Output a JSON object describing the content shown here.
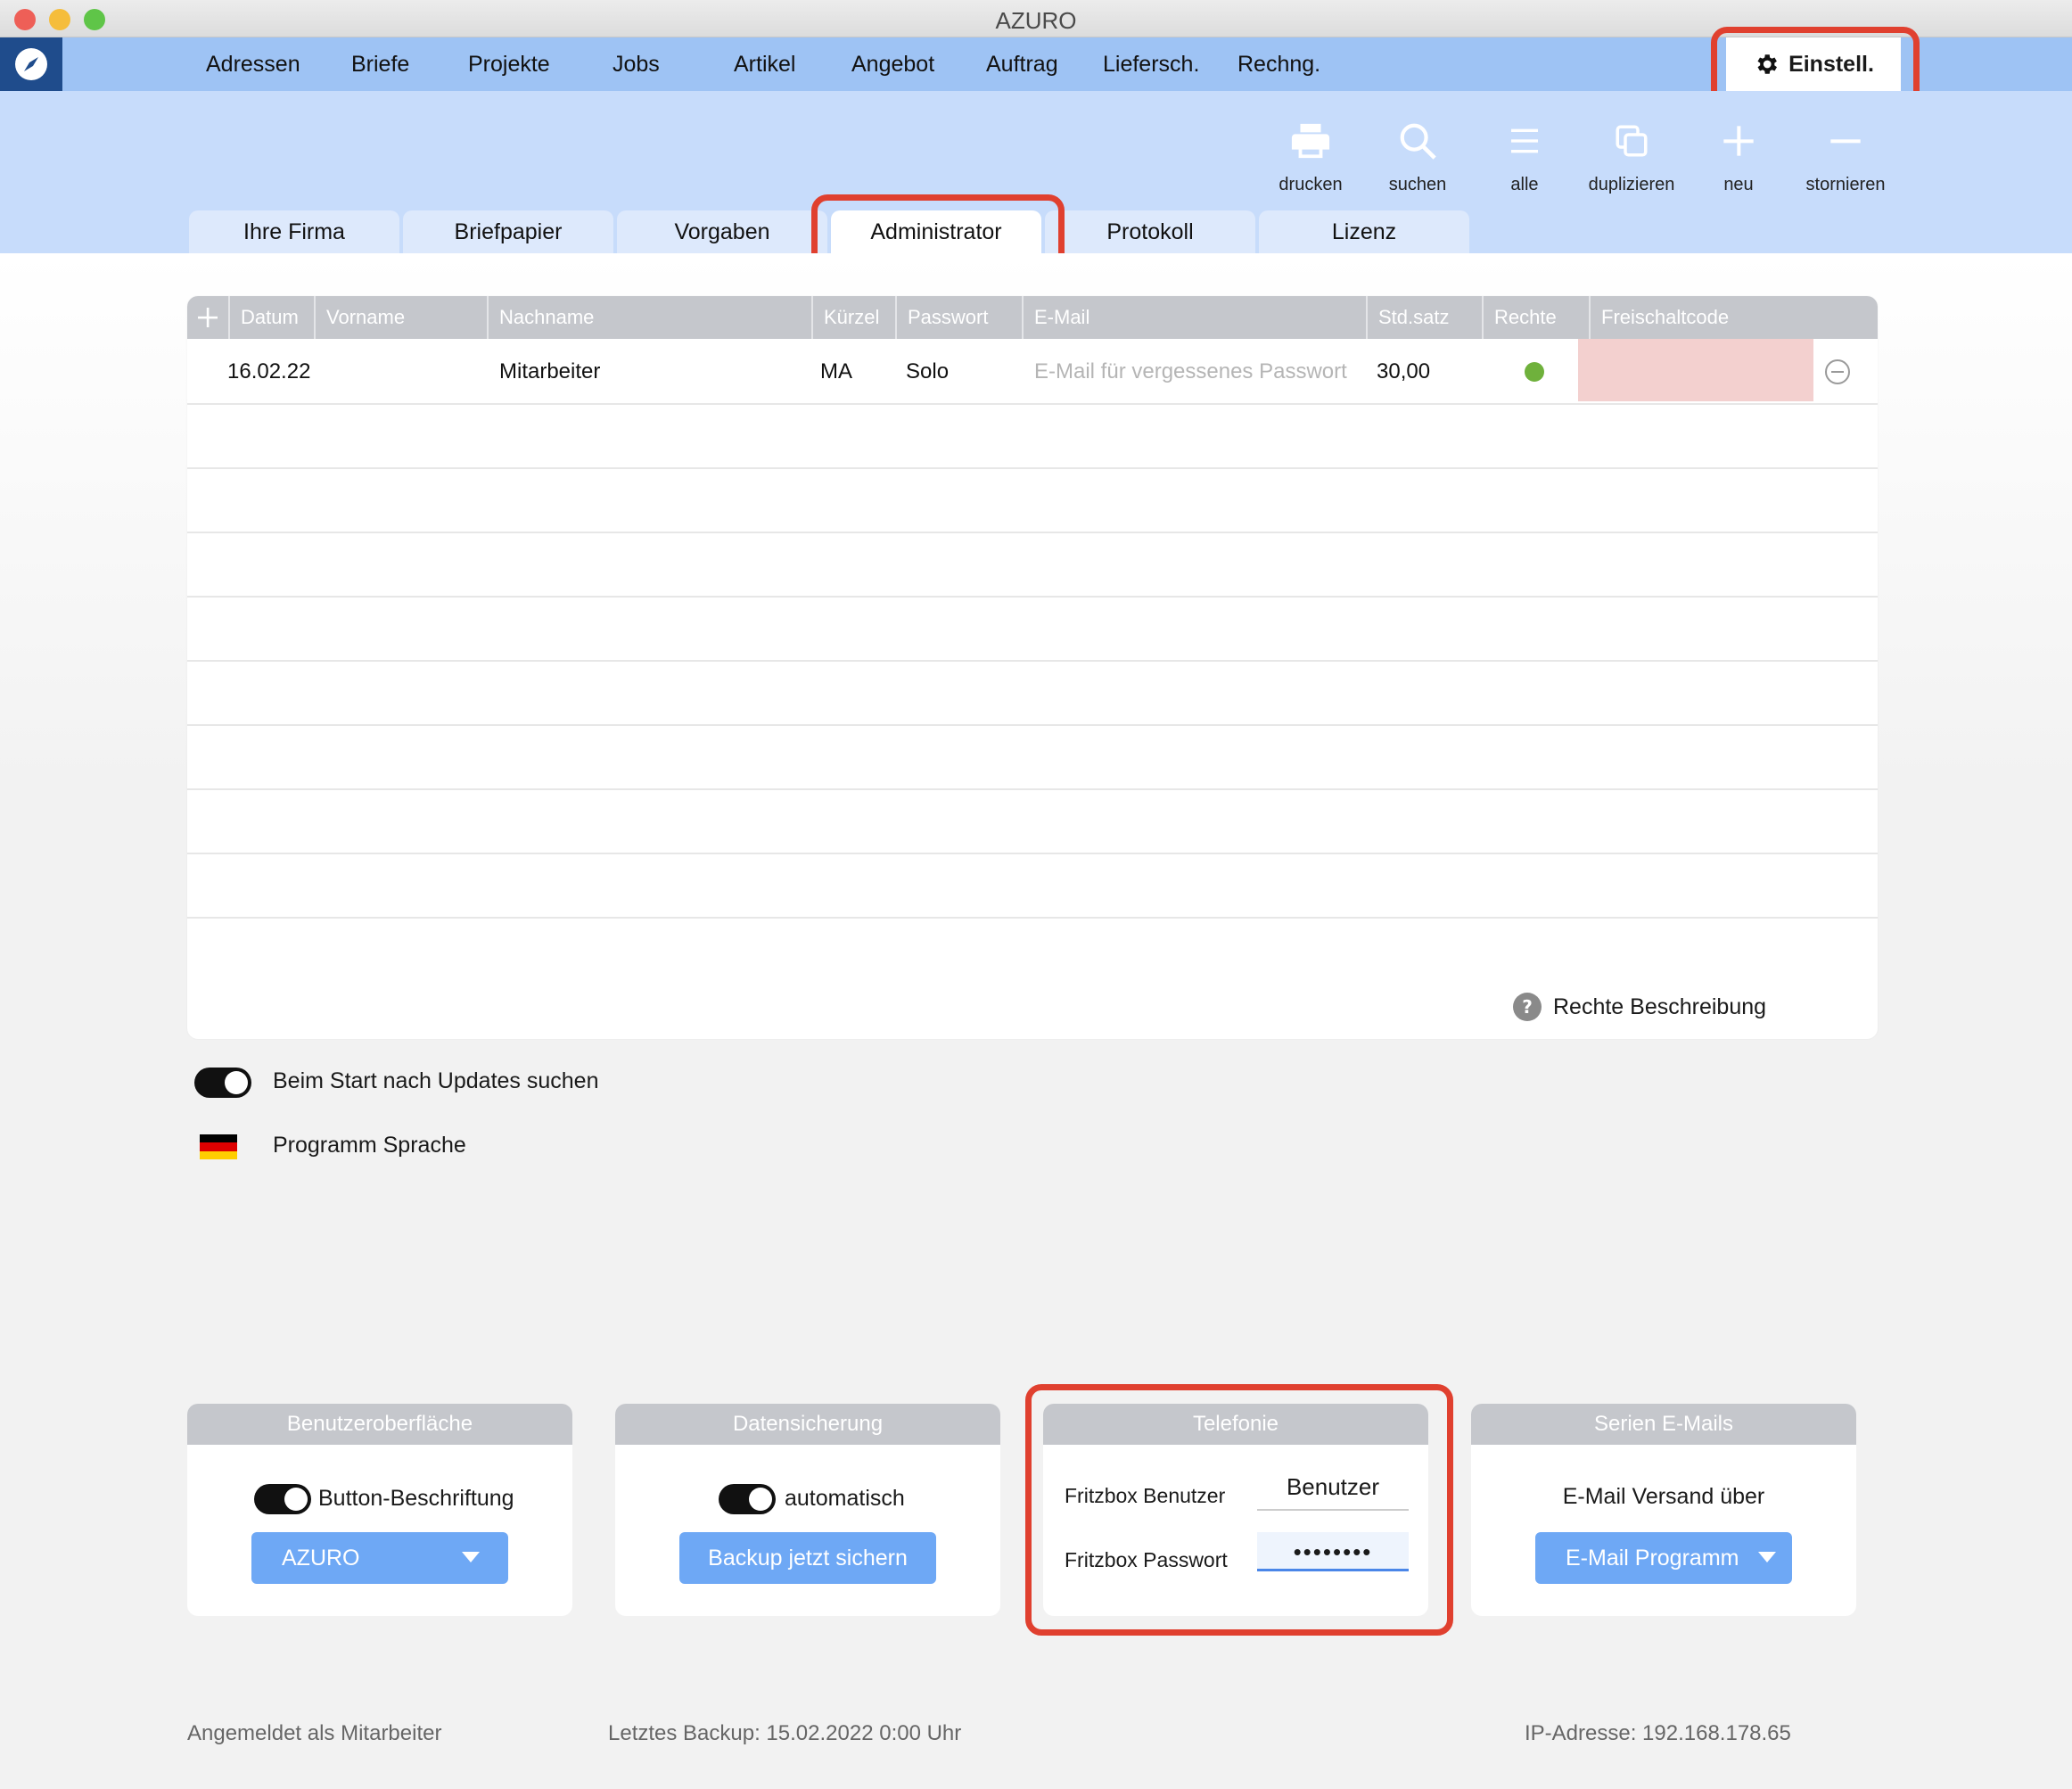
{
  "window": {
    "title": "AZURO"
  },
  "menu": {
    "items": [
      "Adressen",
      "Briefe",
      "Projekte",
      "Jobs",
      "Artikel",
      "Angebot",
      "Auftrag",
      "Liefersch.",
      "Rechng."
    ],
    "settings_label": "Einstell."
  },
  "toolbar": {
    "tools": [
      {
        "label": "drucken",
        "icon": "print-icon"
      },
      {
        "label": "suchen",
        "icon": "search-icon"
      },
      {
        "label": "alle",
        "icon": "list-icon"
      },
      {
        "label": "duplizieren",
        "icon": "duplicate-icon"
      },
      {
        "label": "neu",
        "icon": "plus-icon"
      },
      {
        "label": "stornieren",
        "icon": "minus-icon"
      }
    ]
  },
  "tabs": [
    "Ihre Firma",
    "Briefpapier",
    "Vorgaben",
    "Administrator",
    "Protokoll",
    "Lizenz"
  ],
  "active_tab": "Administrator",
  "table": {
    "columns": [
      "Datum",
      "Vorname",
      "Nachname",
      "Kürzel",
      "Passwort",
      "E-Mail",
      "Std.satz",
      "Rechte",
      "Freischaltcode"
    ],
    "rows": [
      {
        "datum": "16.02.22",
        "vorname": "",
        "nachname": "Mitarbeiter",
        "kuerzel": "MA",
        "passwort": "Solo",
        "email_placeholder": "E-Mail für vergessenes Passwort",
        "stdsatz": "30,00",
        "rechte_color": "#6fb13c"
      }
    ],
    "rights_help": "Rechte Beschreibung"
  },
  "options": {
    "updates_label": "Beim Start nach Updates suchen",
    "language_label": "Programm Sprache"
  },
  "panels": {
    "ui": {
      "title": "Benutzeroberfläche",
      "toggle_label": "Button-Beschriftung",
      "select_value": "AZURO"
    },
    "backup": {
      "title": "Datensicherung",
      "toggle_label": "automatisch",
      "button": "Backup jetzt sichern"
    },
    "phone": {
      "title": "Telefonie",
      "user_label": "Fritzbox Benutzer",
      "user_value": "Benutzer",
      "pw_label": "Fritzbox Passwort",
      "pw_value": "••••••••"
    },
    "mail": {
      "title": "Serien E-Mails",
      "label": "E-Mail Versand über",
      "select_value": "E-Mail Programm"
    }
  },
  "status": {
    "user": "Angemeldet als Mitarbeiter",
    "backup": "Letztes Backup: 15.02.2022 0:00 Uhr",
    "ip": "IP-Adresse: 192.168.178.65"
  },
  "colors": {
    "accent": "#9ec3f4",
    "highlight": "#e0402f",
    "button": "#6ea8f5"
  }
}
